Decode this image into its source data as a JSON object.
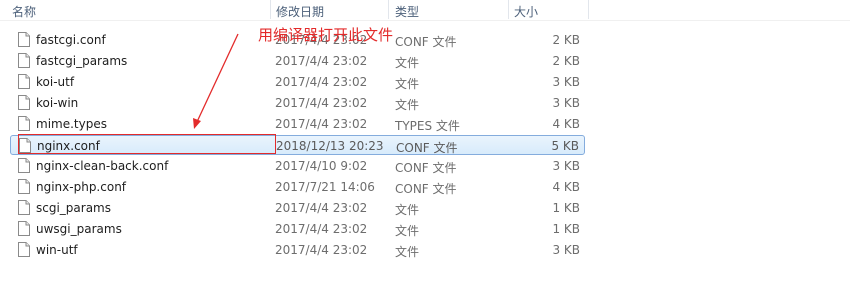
{
  "columns": {
    "name": "名称",
    "date": "修改日期",
    "type": "类型",
    "size": "大小"
  },
  "files": [
    {
      "name": "fastcgi.conf",
      "date": "2017/4/4 23:02",
      "type": "CONF 文件",
      "size": "2 KB"
    },
    {
      "name": "fastcgi_params",
      "date": "2017/4/4 23:02",
      "type": "文件",
      "size": "2 KB"
    },
    {
      "name": "koi-utf",
      "date": "2017/4/4 23:02",
      "type": "文件",
      "size": "3 KB"
    },
    {
      "name": "koi-win",
      "date": "2017/4/4 23:02",
      "type": "文件",
      "size": "3 KB"
    },
    {
      "name": "mime.types",
      "date": "2017/4/4 23:02",
      "type": "TYPES 文件",
      "size": "4 KB"
    },
    {
      "name": "nginx.conf",
      "date": "2018/12/13 20:23",
      "type": "CONF 文件",
      "size": "5 KB",
      "selected": true
    },
    {
      "name": "nginx-clean-back.conf",
      "date": "2017/4/10 9:02",
      "type": "CONF 文件",
      "size": "3 KB"
    },
    {
      "name": "nginx-php.conf",
      "date": "2017/7/21 14:06",
      "type": "CONF 文件",
      "size": "4 KB"
    },
    {
      "name": "scgi_params",
      "date": "2017/4/4 23:02",
      "type": "文件",
      "size": "1 KB"
    },
    {
      "name": "uwsgi_params",
      "date": "2017/4/4 23:02",
      "type": "文件",
      "size": "1 KB"
    },
    {
      "name": "win-utf",
      "date": "2017/4/4 23:02",
      "type": "文件",
      "size": "3 KB"
    }
  ],
  "annotation": {
    "text": "用编译器打开此文件",
    "color": "#e32b2b"
  },
  "colors": {
    "selection_border": "#84acdd",
    "selection_fill": "#d8ebfb",
    "header_text": "#4c607a"
  }
}
